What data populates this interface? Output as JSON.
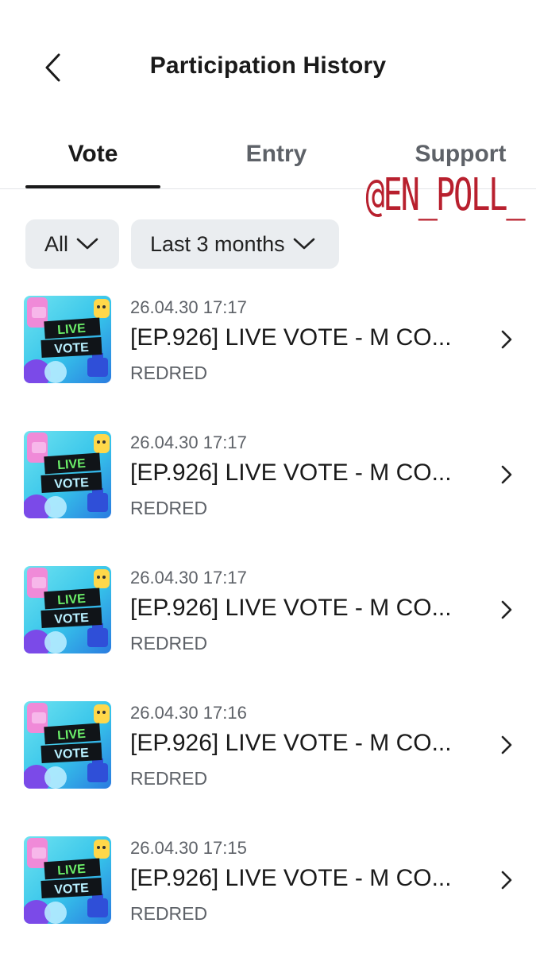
{
  "header": {
    "title": "Participation History",
    "back_icon": "chevron-left-icon"
  },
  "tabs": [
    {
      "label": "Vote",
      "active": true
    },
    {
      "label": "Entry",
      "active": false
    },
    {
      "label": "Support",
      "active": false
    }
  ],
  "watermark": "@EN_POLL_",
  "filters": {
    "category": "All",
    "period": "Last 3 months"
  },
  "items": [
    {
      "date": "26.04.30 17:17",
      "title": "[EP.926] LIVE VOTE - M CO...",
      "subtitle": "REDRED"
    },
    {
      "date": "26.04.30 17:17",
      "title": "[EP.926] LIVE VOTE - M CO...",
      "subtitle": "REDRED"
    },
    {
      "date": "26.04.30 17:17",
      "title": "[EP.926] LIVE VOTE - M CO...",
      "subtitle": "REDRED"
    },
    {
      "date": "26.04.30 17:16",
      "title": "[EP.926] LIVE VOTE - M CO...",
      "subtitle": "REDRED"
    },
    {
      "date": "26.04.30 17:15",
      "title": "[EP.926] LIVE VOTE - M CO...",
      "subtitle": "REDRED"
    }
  ],
  "thumbnail": {
    "line1": "LIVE",
    "line2": "VOTE"
  },
  "colors": {
    "watermark": "#b8202e",
    "active_tab": "#1a1a1a",
    "inactive_tab": "#5e6268",
    "chip_bg": "#eaedf0"
  }
}
